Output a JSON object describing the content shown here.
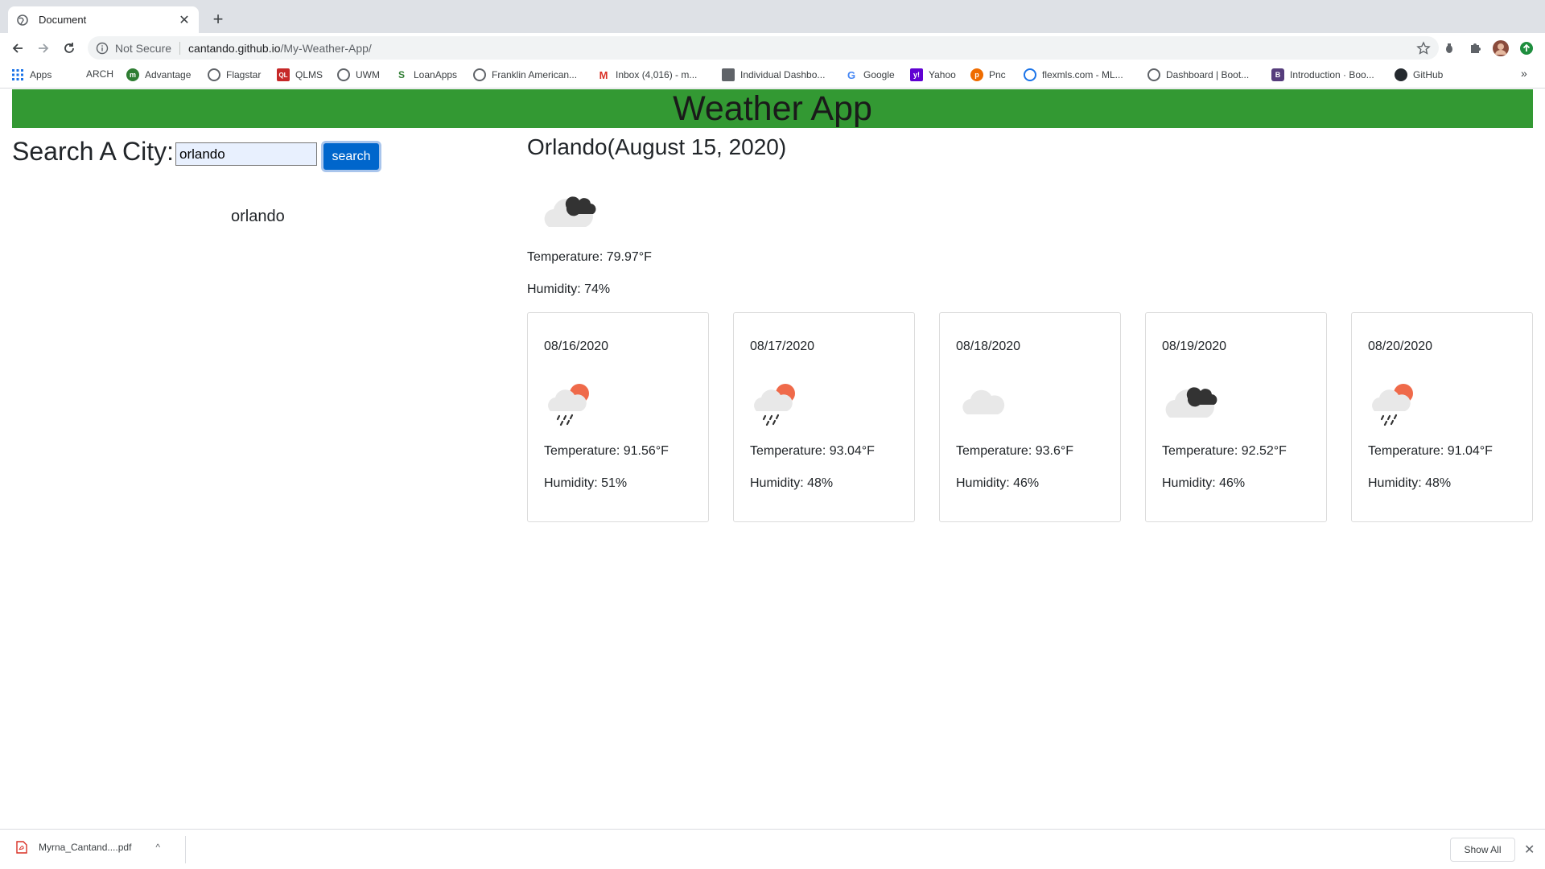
{
  "browser": {
    "tab_title": "Document",
    "tab_close": "✕",
    "new_tab": "+",
    "security_label": "Not Secure",
    "url_host": "cantando.github.io",
    "url_path": "/My-Weather-App/",
    "icons": [
      "back-icon",
      "forward-icon",
      "reload-icon",
      "info-icon",
      "star-icon",
      "extension-icon",
      "puzzle-icon",
      "avatar",
      "update-icon"
    ]
  },
  "bookmarks": [
    {
      "label": "Apps",
      "icon": "apps-grid-icon"
    },
    {
      "label": "ARCH",
      "icon": ""
    },
    {
      "label": "Advantage",
      "icon": "advantage-icon"
    },
    {
      "label": "Flagstar",
      "icon": "globe-icon"
    },
    {
      "label": "QLMS",
      "icon": "ql-icon"
    },
    {
      "label": "UWM",
      "icon": "globe-icon"
    },
    {
      "label": "LoanApps",
      "icon": "loanapps-icon"
    },
    {
      "label": "Franklin American...",
      "icon": "globe-icon"
    },
    {
      "label": "Inbox (4,016) - m...",
      "icon": "gmail-icon"
    },
    {
      "label": "Individual Dashbo...",
      "icon": "dashboard-icon"
    },
    {
      "label": "Google",
      "icon": "google-icon"
    },
    {
      "label": "Yahoo",
      "icon": "yahoo-icon"
    },
    {
      "label": "Pnc",
      "icon": "pnc-icon"
    },
    {
      "label": "flexmls.com - ML...",
      "icon": "flexmls-icon"
    },
    {
      "label": "Dashboard | Boot...",
      "icon": "globe-icon"
    },
    {
      "label": "Introduction · Boo...",
      "icon": "bootstrap-icon"
    },
    {
      "label": "GitHub",
      "icon": "github-icon"
    }
  ],
  "bookmarks_overflow": "»",
  "app": {
    "title": "Weather App",
    "search_label": "Search A City:",
    "search_value": "orlando",
    "search_button": "search",
    "history": [
      "orlando"
    ]
  },
  "current": {
    "title": "Orlando(August 15, 2020)",
    "icon": "broken-clouds-icon",
    "temperature": "Temperature: 79.97°F",
    "humidity": "Humidity: 74%"
  },
  "forecast": [
    {
      "date": "08/16/2020",
      "icon": "sun-rain-icon",
      "temperature": "Temperature: 91.56°F",
      "humidity": "Humidity: 51%"
    },
    {
      "date": "08/17/2020",
      "icon": "sun-rain-icon",
      "temperature": "Temperature: 93.04°F",
      "humidity": "Humidity: 48%"
    },
    {
      "date": "08/18/2020",
      "icon": "cloud-icon",
      "temperature": "Temperature: 93.6°F",
      "humidity": "Humidity: 46%"
    },
    {
      "date": "08/19/2020",
      "icon": "broken-clouds-icon",
      "temperature": "Temperature: 92.52°F",
      "humidity": "Humidity: 46%"
    },
    {
      "date": "08/20/2020",
      "icon": "sun-rain-icon",
      "temperature": "Temperature: 91.04°F",
      "humidity": "Humidity: 48%"
    }
  ],
  "downloads": {
    "file": "Myrna_Cantand....pdf",
    "chevron": "^",
    "show_all": "Show All",
    "close": "✕"
  },
  "colors": {
    "header_bg": "#339933",
    "button_bg": "#0066cc",
    "sun": "#ef6a4a",
    "dark_cloud": "#333333",
    "light_cloud": "#e8e8e8"
  }
}
